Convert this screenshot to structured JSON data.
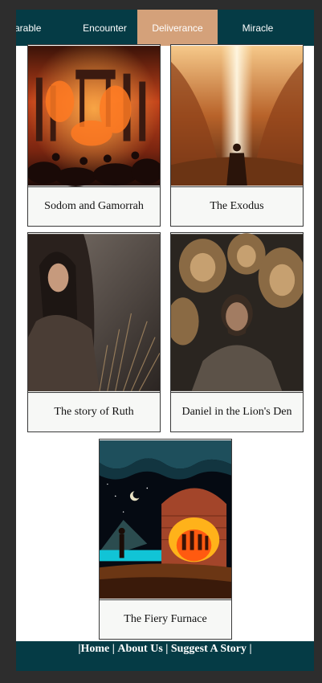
{
  "tabs": [
    {
      "label": "Parable"
    },
    {
      "label": "Encounter"
    },
    {
      "label": "Deliverance",
      "active": true
    },
    {
      "label": "Miracle"
    }
  ],
  "cards": [
    {
      "title": "Sodom and Gamorrah",
      "image": "burning-city-image"
    },
    {
      "title": "The Exodus",
      "image": "parting-sea-image"
    },
    {
      "title": "The story of Ruth",
      "image": "woman-in-wheat-field-image"
    },
    {
      "title": "Daniel in the Lion's Den",
      "image": "man-with-lions-image"
    },
    {
      "title": "The Fiery Furnace",
      "image": "furnace-image"
    }
  ],
  "footer": {
    "sep": "|",
    "home": "Home",
    "about": "About Us",
    "suggest": "Suggest A Story"
  },
  "colors": {
    "nav_bg": "#053b45",
    "active_tab": "#d4a17a",
    "card_bg": "#f7f8f6"
  }
}
